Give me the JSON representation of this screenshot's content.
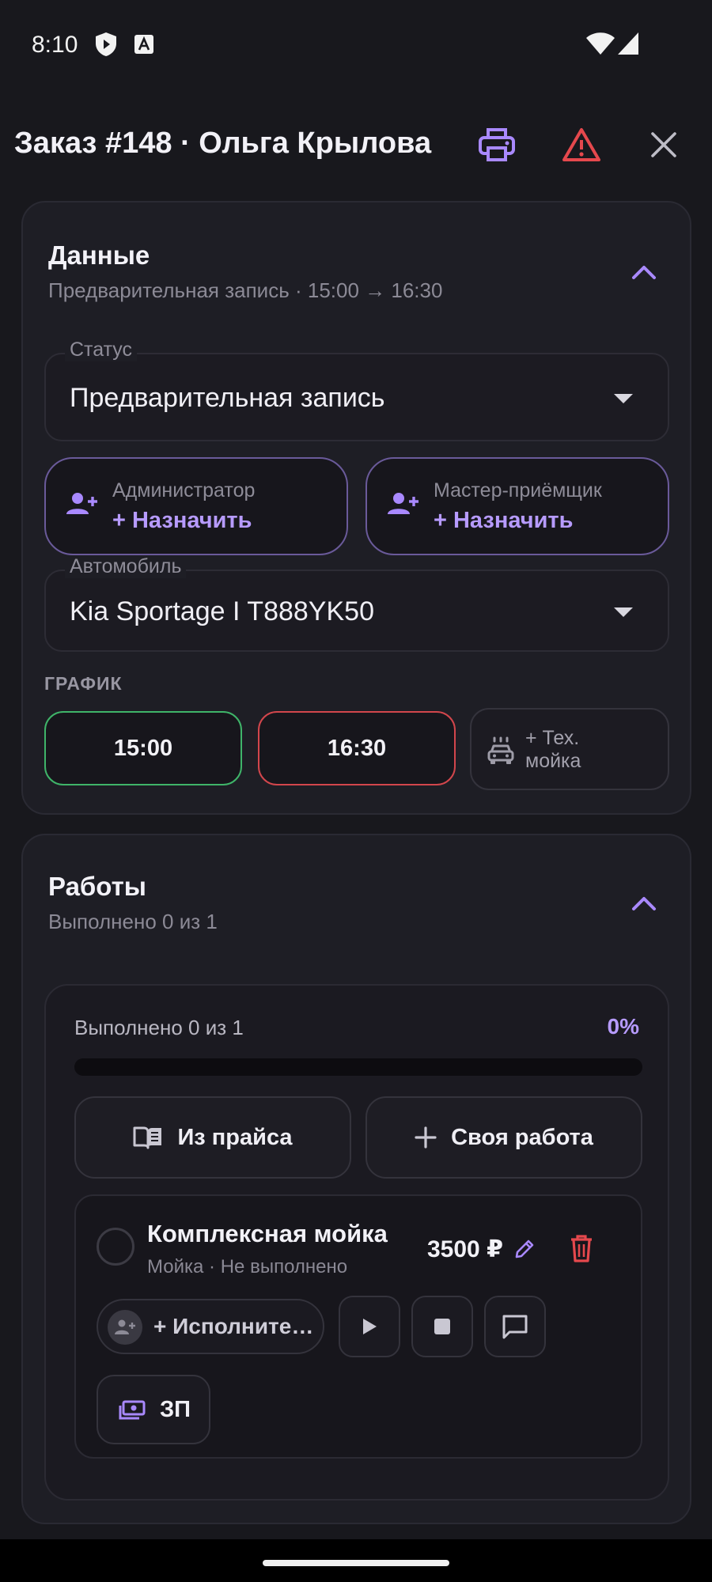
{
  "status_bar": {
    "time": "8:10",
    "icons": [
      "shield-icon",
      "font-a-icon",
      "wifi-icon",
      "signal-icon"
    ]
  },
  "header": {
    "title": "Заказ #148 · Ольга Крылова",
    "actions": [
      "printer-icon",
      "warning-icon",
      "close-icon"
    ],
    "accent_color": "#a989ff",
    "warning_color": "#e5484d"
  },
  "data_card": {
    "title": "Данные",
    "subtitle": "Предварительная запись · 15:00 → 16:30",
    "status": {
      "label": "Статус",
      "value": "Предварительная запись"
    },
    "administrator": {
      "label": "Администратор",
      "action": "+ Назначить"
    },
    "receiver": {
      "label": "Мастер-приёмщик",
      "action": "+ Назначить"
    },
    "car": {
      "label": "Автомобиль",
      "value": "Kia Sportage I T888YK50"
    },
    "schedule": {
      "caption": "ГРАФИК",
      "start": "15:00",
      "end": "16:30",
      "start_color": "#3fb469",
      "end_color": "#d2464c",
      "wash_line1": "+ Тех.",
      "wash_line2": "мойка"
    }
  },
  "works_card": {
    "title": "Работы",
    "subtitle": "Выполнено 0 из 1",
    "progress": {
      "label": "Выполнено 0 из 1",
      "percent_text": "0%",
      "fraction": 0
    },
    "from_price_label": "Из прайса",
    "custom_work_label": "Своя работа",
    "item": {
      "title": "Комплексная мойка",
      "subtitle": "Мойка · Не выполнено",
      "price": "3500 ₽",
      "performer_label": "+ Исполните…",
      "zp_label": "ЗП"
    }
  }
}
